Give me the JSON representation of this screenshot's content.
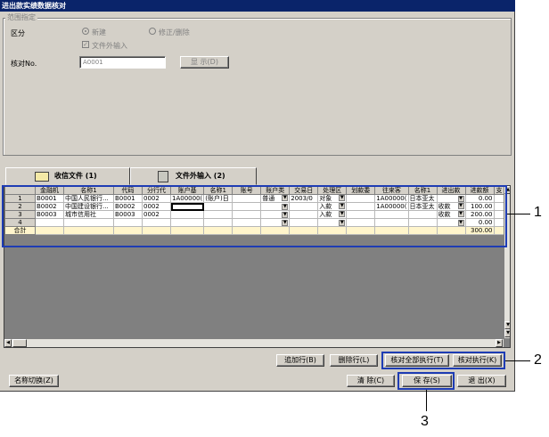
{
  "window": {
    "title": "进出款实绩数据核对"
  },
  "range_group": {
    "legend": "范围指定"
  },
  "kubun": {
    "label": "区分",
    "option_new": "新建",
    "option_edit": "修正/删除",
    "checkbox_label": "文件外输入"
  },
  "check_no": {
    "label": "核对No.",
    "value": "A0001",
    "display_button": "显 示(D)"
  },
  "tabs": [
    {
      "label": "收信文件 (1)",
      "icon": "book-icon"
    },
    {
      "label": "文件外输入 (2)",
      "icon": "document-icon"
    }
  ],
  "grid": {
    "columns": [
      "",
      "金融机",
      "名称1",
      "代码",
      "分行代",
      "账户基",
      "名称1",
      "账号",
      "账户类",
      "交易日",
      "处理区",
      "划款委",
      "往来客",
      "名称1",
      "进出款",
      "进款额",
      "支"
    ],
    "rows": [
      [
        "1",
        "B0001",
        "中国人民银行...",
        "B0001",
        "0002",
        "1A00000(",
        "(账户)日",
        "",
        "普通",
        "2003/0",
        "对象",
        "",
        "1A00000(",
        "日本亚太",
        "",
        "0.00"
      ],
      [
        "2",
        "B0002",
        "中国建设银行...",
        "B0002",
        "0002",
        "",
        "",
        "",
        "",
        "",
        "入款",
        "",
        "1A00000(",
        "日本亚太",
        "收款",
        "100.00"
      ],
      [
        "3",
        "B0003",
        "城市信用社",
        "B0003",
        "0002",
        "",
        "",
        "",
        "",
        "",
        "入款",
        "",
        "",
        "",
        "收款",
        "200.00"
      ],
      [
        "4",
        "",
        "",
        "",
        "",
        "",
        "",
        "",
        "",
        "",
        "",
        "",
        "",
        "",
        "",
        "0.00"
      ]
    ],
    "total": {
      "label": "合計",
      "value": "300.00"
    }
  },
  "buttons": {
    "add_row": "追加行(B)",
    "delete_row": "删除行(L)",
    "check_all": "核对全部执行(T)",
    "check_exec": "核对执行(K)",
    "name_switch": "名称切换(Z)",
    "clear": "清 除(C)",
    "save": "保 存(S)",
    "exit": "退 出(X)"
  },
  "callouts": {
    "one": "1",
    "two": "2",
    "three": "3"
  },
  "colors": {
    "title_bar": "#0a246a",
    "callout_border": "#1e3cb4",
    "total_row": "#fff5cc"
  }
}
